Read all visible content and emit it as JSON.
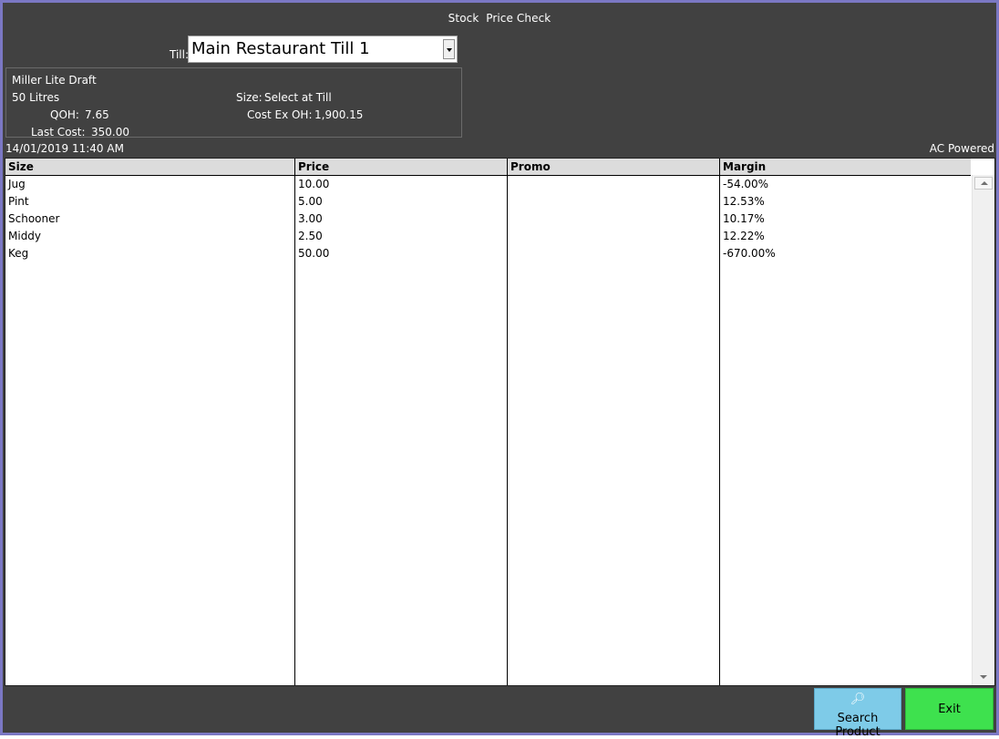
{
  "window": {
    "title": "Stock  Price Check"
  },
  "till": {
    "label": "Till:",
    "selected": "Main Restaurant Till 1"
  },
  "product": {
    "name": "Miller Lite Draft",
    "unit": "50 Litres",
    "size_label": "Size:",
    "size_value": "Select at Till",
    "qoh_label": "QOH:",
    "qoh_value": "7.65",
    "cost_ex_oh_label": "Cost Ex OH:",
    "cost_ex_oh_value": "1,900.15",
    "last_cost_label": "Last Cost:",
    "last_cost_value": "350.00"
  },
  "status": {
    "datetime": "14/01/2019 11:40 AM",
    "power": "AC Powered"
  },
  "table": {
    "columns": [
      "Size",
      "Price",
      "Promo",
      "Margin"
    ],
    "rows": [
      [
        "Jug",
        "10.00",
        "",
        "-54.00%"
      ],
      [
        "Pint",
        "5.00",
        "",
        "12.53%"
      ],
      [
        "Schooner",
        "3.00",
        "",
        "10.17%"
      ],
      [
        "Middy",
        "2.50",
        "",
        "12.22%"
      ],
      [
        "Keg",
        "50.00",
        "",
        "-670.00%"
      ]
    ]
  },
  "buttons": {
    "search_icon": "search-icon",
    "search_label": "Search Product",
    "exit_label": "Exit"
  },
  "colors": {
    "background": "#414141",
    "border": "#7b78c4",
    "search_button": "#7ecbe8",
    "exit_button": "#3ee14e"
  }
}
